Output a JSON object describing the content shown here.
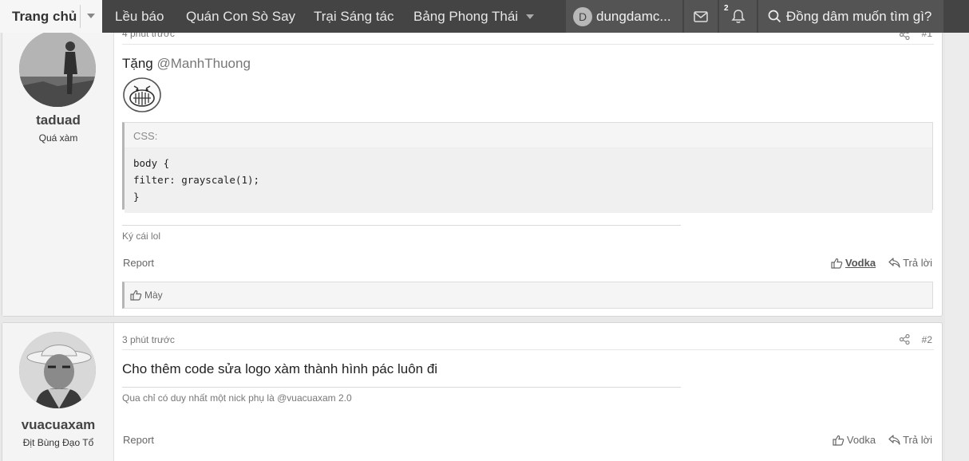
{
  "nav": {
    "home": "Trang chủ",
    "links": [
      "Lều báo",
      "Quán Con Sò Say",
      "Trại Sáng tác",
      "Bảng Phong Thái"
    ],
    "user_initial": "D",
    "username": "dungdamc...",
    "alerts_count": "2",
    "search_placeholder": "Đồng dâm muốn tìm gì?"
  },
  "posts": [
    {
      "username": "taduad",
      "user_title": "Quá xàm",
      "time": "4 phút trước",
      "number": "#1",
      "body_prefix": "Tặng ",
      "mention": "@ManhThuong",
      "code": {
        "title": "CSS:",
        "lines": [
          "body {",
          "filter: grayscale(1);",
          "}"
        ]
      },
      "signature": "Ký cái lol",
      "report": "Report",
      "like_label": "Vodka",
      "reply_label": "Trả lời",
      "reactions": "Mày"
    },
    {
      "username": "vuacuaxam",
      "user_title": "Địt Bùng Đạo Tổ",
      "time": "3 phút trước",
      "number": "#2",
      "body": "Cho thêm code sửa logo xàm thành hình pác luôn đi",
      "signature": "Qua chỉ có duy nhất một nick phụ là @vuacuaxam 2.0",
      "report": "Report",
      "like_label": "Vodka",
      "reply_label": "Trả lời"
    }
  ]
}
